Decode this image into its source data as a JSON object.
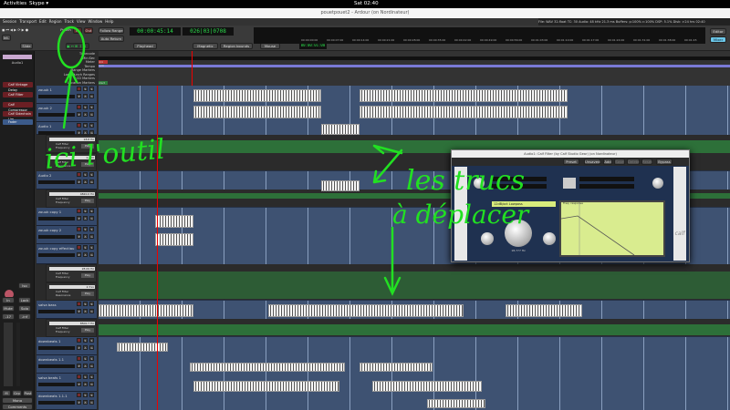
{
  "gnome": {
    "activities": "Activities",
    "app": "Skype ▾",
    "clock": "Sat 02:40"
  },
  "window": {
    "title": "pouetpouet2 - Ardour (on Nordinateur)"
  },
  "menu": [
    "Session",
    "Transport",
    "Edit",
    "Region",
    "Track",
    "View",
    "Window",
    "Help"
  ],
  "toolbar": {
    "punch": "Punch",
    "in": "In",
    "out": "Out",
    "follow_range": "Follow Range",
    "auto_return": "Auto Return",
    "clock_primary": "00:00:45:14",
    "clock_secondary": "026|03|0708",
    "slide": "Slide",
    "playhead": "Playhead",
    "magnetic": "Magnetic",
    "region_bounds": "Region bounds",
    "mouse": "Mouse",
    "nudge_clock": "00:00:01:00",
    "editor": "Editor",
    "mixer": "Mixer",
    "int_label": "Int.",
    "shuttle": "Shuttle"
  },
  "status": {
    "file": "File: WAV 32-float",
    "tc": "TC: 30",
    "audio": "Audio: 48 kHz 21.3 ms",
    "buffers": "Buffers: p:100% c:100%",
    "dsp": "DSP: 5.1%",
    "disk": "Disk: >24 hrs",
    "time": "02:40"
  },
  "mini_ticks": [
    "00:00:00:00",
    "00:00:07:00",
    "00:00:14:00",
    "00:00:21:00",
    "00:00:28:00",
    "00:00:35:00",
    "00:00:42:00",
    "00:00:49:00",
    "00:00:56:00",
    "00:01:03:00",
    "00:01:10:00",
    "00:01:17:00",
    "00:01:24:00",
    "00:01:31:00",
    "00:01:38:00",
    "00:01:45"
  ],
  "left_panel": {
    "strip": "Audio1",
    "plugins": [
      "Calf Vintage Delay",
      "Calf Filter",
      "Calf Compressor",
      "Calf Sidechain Lim",
      "Fader"
    ],
    "iso": "Iso",
    "lock": "Lock",
    "in": "In",
    "disk": "Disk",
    "mute": "Mute",
    "solo": "Solo",
    "m1": "-17",
    "m2": "-inf",
    "bottom": [
      "M",
      "Grp",
      "Post"
    ],
    "mono": "Mono",
    "comments": "Comments"
  },
  "rulers": [
    "Timecode",
    "Min:Sec",
    "Meter",
    "Tempo",
    "Range Markers",
    "Loop/Punch Ranges",
    "CD Markers",
    "Location Markers"
  ],
  "ruler_values": {
    "tempo": "120",
    "meter": "4/4",
    "marker": "start"
  },
  "tracks": [
    {
      "name": "zouuk 1"
    },
    {
      "name": "zouuk 2"
    },
    {
      "name": "Audio 1"
    },
    {
      "name": "Audio 2"
    },
    {
      "name": "zouuk copy 1"
    },
    {
      "name": "zouuk copy 2"
    },
    {
      "name": "zouuk copy effectiau"
    },
    {
      "name": "salsa bass"
    },
    {
      "name": "downbeats 1"
    },
    {
      "name": "downbeats 1.1"
    },
    {
      "name": "salsa beats 1"
    },
    {
      "name": "downbeats 1.1.1"
    }
  ],
  "automation": [
    {
      "value": "18.8 Hz",
      "label1": "Calf Filter",
      "label2": "Frequency"
    },
    {
      "value": "1.000",
      "label1": "Calf Filter",
      "label2": "Resonance"
    },
    {
      "value": "4820.0 Hz",
      "label1": "Calf Filter",
      "label2": "Frequency"
    },
    {
      "value": "28.09 Hz",
      "label1": "Calf Filter",
      "label2": "Frequency"
    },
    {
      "value": "2.7xx",
      "label1": "Calf Filter",
      "label2": "Resonance"
    },
    {
      "value": "8500.7 Hz",
      "label1": "Calf Filter",
      "label2": "Frequency"
    }
  ],
  "play_label": "Play",
  "track_buttons": {
    "m": "M",
    "s": "S",
    "p": "P",
    "a": "A",
    "g": "G"
  },
  "plugin": {
    "title": "Audio1: Calf Filter (by Calf Studio Gear) (on Nordinateur)",
    "preset": "Preset",
    "unsaved": "Unsaved",
    "add": "Add",
    "save": "Save",
    "delete": "Delete",
    "reset": "Reset",
    "bypass": "Bypass",
    "mode": "12dB/oct Lowpass",
    "graph_title": "Freq. response",
    "freq_value": "18,777 Hz",
    "brand": "calf"
  },
  "annotations": {
    "tool": "ici l'outil",
    "things": "les trucs",
    "move": "à déplacer"
  },
  "colors": {
    "accent_green": "#2bd94a",
    "annotation": "#22e022",
    "track_blue": "#34486a"
  }
}
